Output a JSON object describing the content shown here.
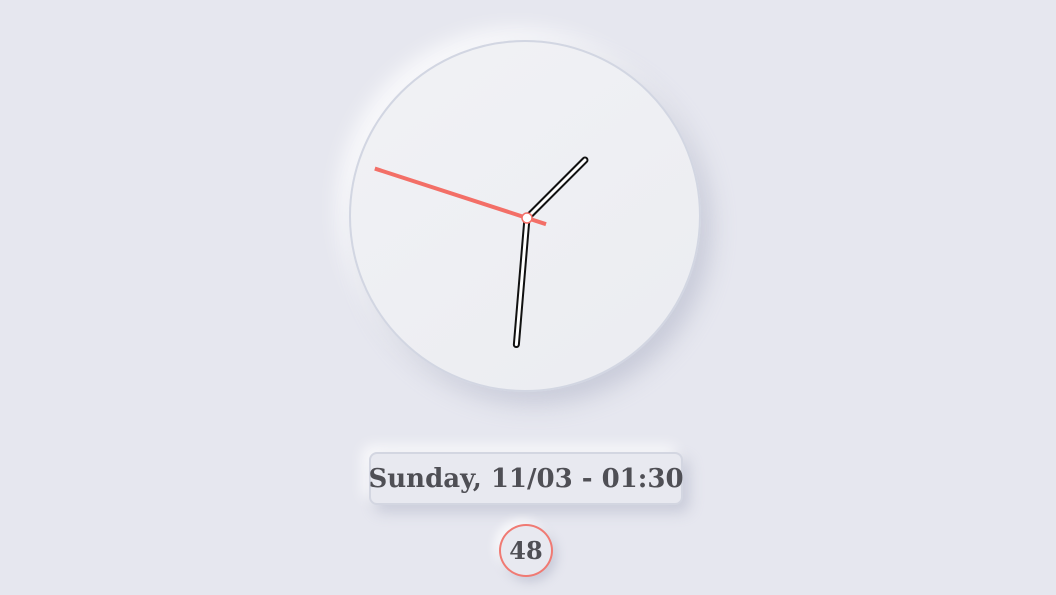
{
  "clock": {
    "time": {
      "hours": 1,
      "minutes": 30,
      "seconds": 48
    },
    "colors": {
      "face": "#eeeff3",
      "hand_outline": "#111111",
      "hand_fill": "#ffffff",
      "second_hand": "#f36f67",
      "background": "#e6e7ef"
    }
  },
  "date_display": {
    "text": "Sunday, 11/03 - 01:30"
  },
  "seconds_badge": {
    "text": "48"
  }
}
